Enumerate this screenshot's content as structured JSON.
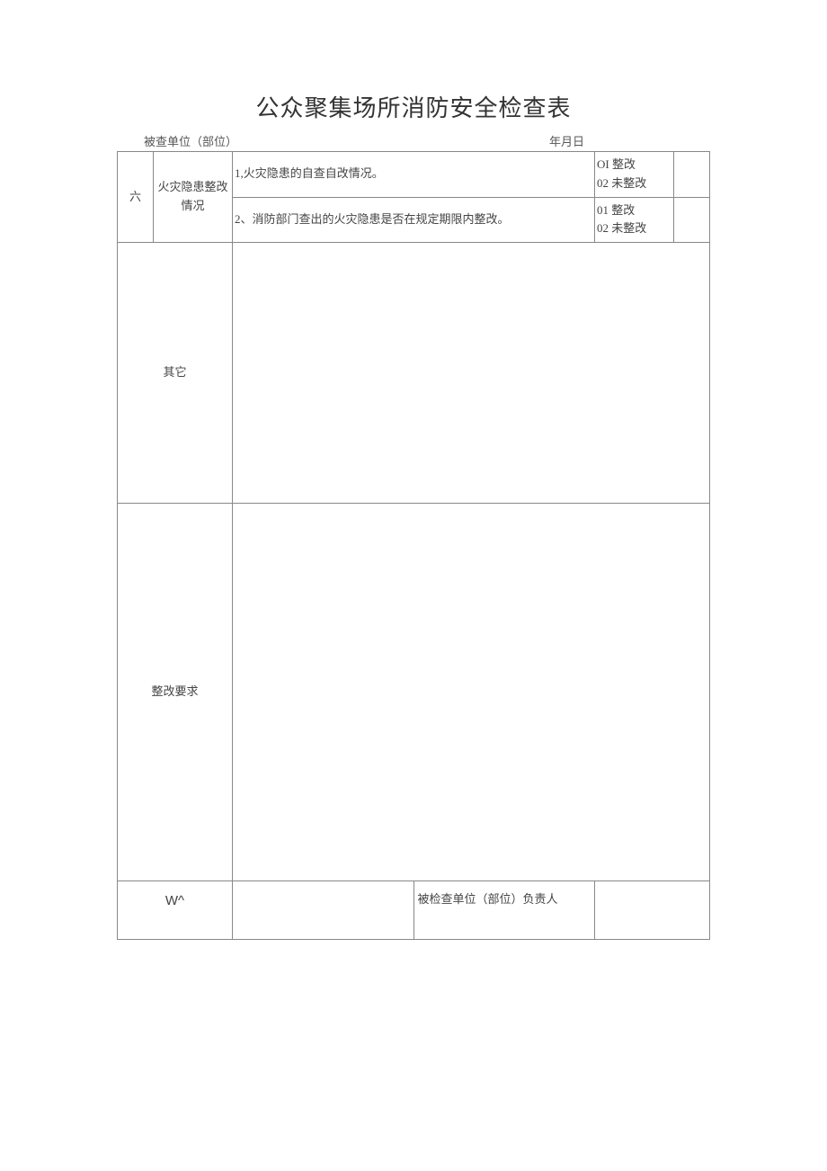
{
  "title": "公众聚集场所消防安全检查表",
  "meta": {
    "unit_label": "被查单位（部位）",
    "date_label": "年月日"
  },
  "section6": {
    "num": "六",
    "category": "火灾隐患整改情况",
    "item1": "1,火灾隐患的自查自改情况。",
    "item1_status1": "OI 整改",
    "item1_status2": "02 未整改",
    "item2": "2、消防部门查出的火灾隐患是否在规定期限内整改。",
    "item2_status1": "01 整改",
    "item2_status2": "02 未整改"
  },
  "other_label": "其它",
  "require_label": "整改要求",
  "sig": {
    "left": "W^",
    "right": "被检查单位（部位）负责人"
  }
}
